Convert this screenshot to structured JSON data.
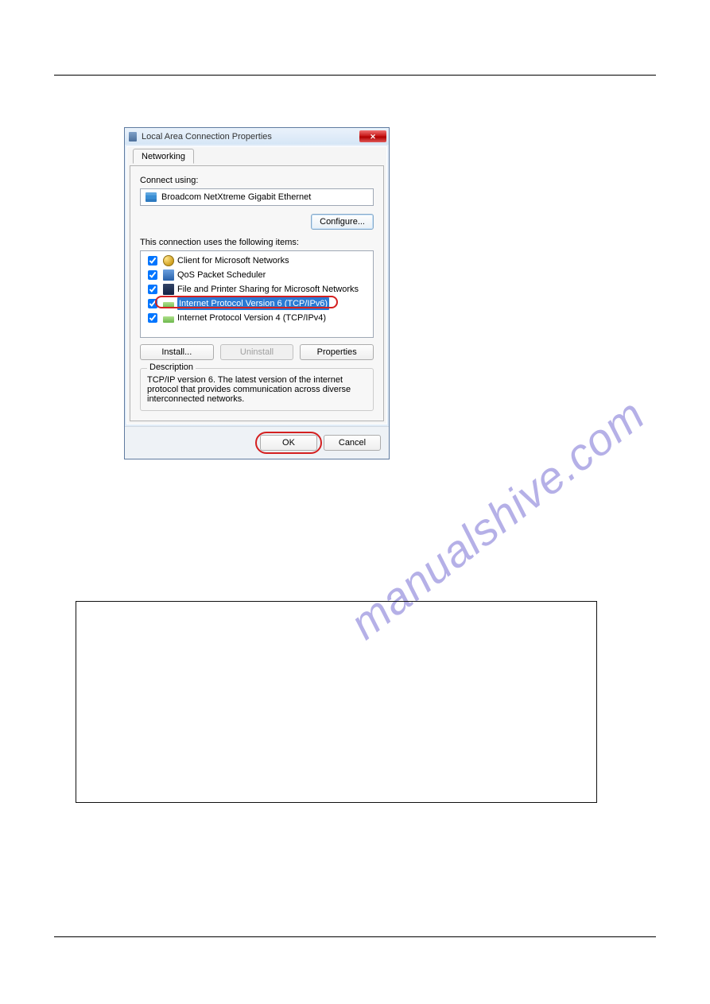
{
  "watermark": "manualshive.com",
  "page_header": {
    "left": "",
    "right": ""
  },
  "page_footer": {
    "left": "",
    "right": ""
  },
  "fig_caption": "",
  "note_label": "",
  "dialog": {
    "title": "Local Area Connection Properties",
    "tab": "Networking",
    "connect_using_label": "Connect using:",
    "adapter": "Broadcom NetXtreme Gigabit Ethernet",
    "configure_btn": "Configure...",
    "items_label": "This connection uses the following items:",
    "items": [
      {
        "label": "Client for Microsoft Networks",
        "checked": true,
        "icon": "nets"
      },
      {
        "label": "QoS Packet Scheduler",
        "checked": true,
        "icon": "qos"
      },
      {
        "label": "File and Printer Sharing for Microsoft Networks",
        "checked": true,
        "icon": "share"
      },
      {
        "label": "Internet Protocol Version 6 (TCP/IPv6)",
        "checked": true,
        "icon": "proto",
        "highlight": true
      },
      {
        "label": "Internet Protocol Version 4 (TCP/IPv4)",
        "checked": true,
        "icon": "proto"
      }
    ],
    "install_btn": "Install...",
    "uninstall_btn": "Uninstall",
    "properties_btn": "Properties",
    "description_label": "Description",
    "description_text": "TCP/IP version 6. The latest version of the internet protocol that provides communication across diverse interconnected networks.",
    "ok_btn": "OK",
    "cancel_btn": "Cancel"
  },
  "paragraph_box": {
    "text": ""
  },
  "post_note": ""
}
